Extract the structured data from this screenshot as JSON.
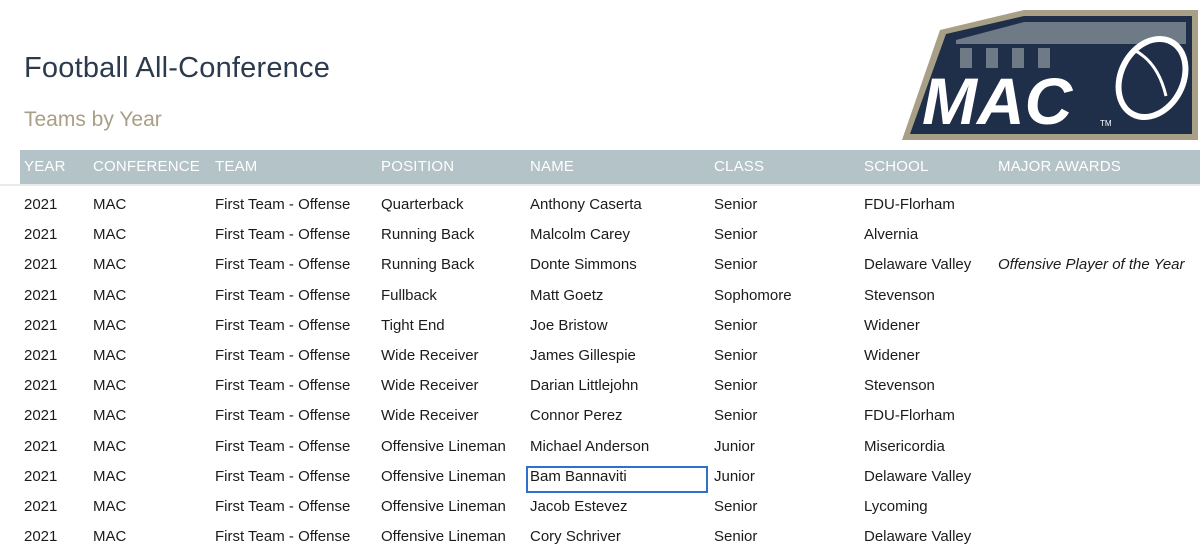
{
  "page": {
    "title": "Football All-Conference",
    "subtitle": "Teams by Year"
  },
  "logo": {
    "text": "MAC",
    "mark": "TM",
    "colors": {
      "navy": "#1f2f49",
      "gray": "#6e7a86",
      "tan": "#a79f86",
      "white": "#ffffff"
    }
  },
  "table": {
    "columns": [
      "YEAR",
      "CONFERENCE",
      "TEAM",
      "POSITION",
      "NAME",
      "CLASS",
      "SCHOOL",
      "MAJOR AWARDS"
    ],
    "rows": [
      [
        "2021",
        "MAC",
        "First Team - Offense",
        "Quarterback",
        "Anthony Caserta",
        "Senior",
        "FDU-Florham",
        ""
      ],
      [
        "2021",
        "MAC",
        "First Team - Offense",
        "Running Back",
        "Malcolm Carey",
        "Senior",
        "Alvernia",
        ""
      ],
      [
        "2021",
        "MAC",
        "First Team - Offense",
        "Running Back",
        "Donte Simmons",
        "Senior",
        "Delaware Valley",
        "Offensive Player of the Year"
      ],
      [
        "2021",
        "MAC",
        "First Team - Offense",
        "Fullback",
        "Matt Goetz",
        "Sophomore",
        "Stevenson",
        ""
      ],
      [
        "2021",
        "MAC",
        "First Team - Offense",
        "Tight End",
        "Joe Bristow",
        "Senior",
        "Widener",
        ""
      ],
      [
        "2021",
        "MAC",
        "First Team - Offense",
        "Wide Receiver",
        "James Gillespie",
        "Senior",
        "Widener",
        ""
      ],
      [
        "2021",
        "MAC",
        "First Team - Offense",
        "Wide Receiver",
        "Darian Littlejohn",
        "Senior",
        "Stevenson",
        ""
      ],
      [
        "2021",
        "MAC",
        "First Team - Offense",
        "Wide Receiver",
        "Connor Perez",
        "Senior",
        "FDU-Florham",
        ""
      ],
      [
        "2021",
        "MAC",
        "First Team - Offense",
        "Offensive Lineman",
        "Michael Anderson",
        "Junior",
        "Misericordia",
        ""
      ],
      [
        "2021",
        "MAC",
        "First Team - Offense",
        "Offensive Lineman",
        "Bam Bannaviti",
        "Junior",
        "Delaware Valley",
        ""
      ],
      [
        "2021",
        "MAC",
        "First Team - Offense",
        "Offensive Lineman",
        "Jacob Estevez",
        "Senior",
        "Lycoming",
        ""
      ],
      [
        "2021",
        "MAC",
        "First Team - Offense",
        "Offensive Lineman",
        "Cory Schriver",
        "Senior",
        "Delaware Valley",
        ""
      ]
    ],
    "selected_cell": {
      "row": 9,
      "col": 4
    },
    "colors": {
      "header_bg": "#b4c3c7",
      "selection": "#2f6fcf"
    }
  }
}
